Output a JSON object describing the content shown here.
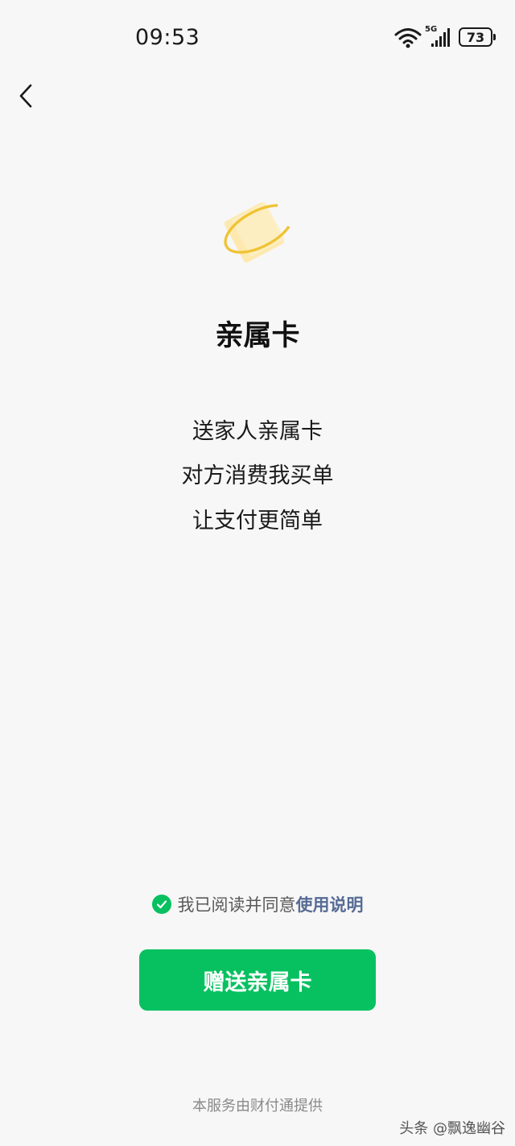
{
  "status_bar": {
    "time": "09:53",
    "network": "5G",
    "battery": "73"
  },
  "page": {
    "title": "亲属卡",
    "description": [
      "送家人亲属卡",
      "对方消费我买单",
      "让支付更简单"
    ]
  },
  "agreement": {
    "text": "我已阅读并同意",
    "link": "使用说明",
    "checked": true
  },
  "primary_button": {
    "label": "赠送亲属卡"
  },
  "footer": {
    "provider": "本服务由财付通提供"
  },
  "watermark": "头条 @飘逸幽谷",
  "colors": {
    "accent": "#07c160",
    "link": "#576b95",
    "background": "#f7f7f7",
    "card_fill": "#fde9b0",
    "ring": "#f0c335"
  }
}
